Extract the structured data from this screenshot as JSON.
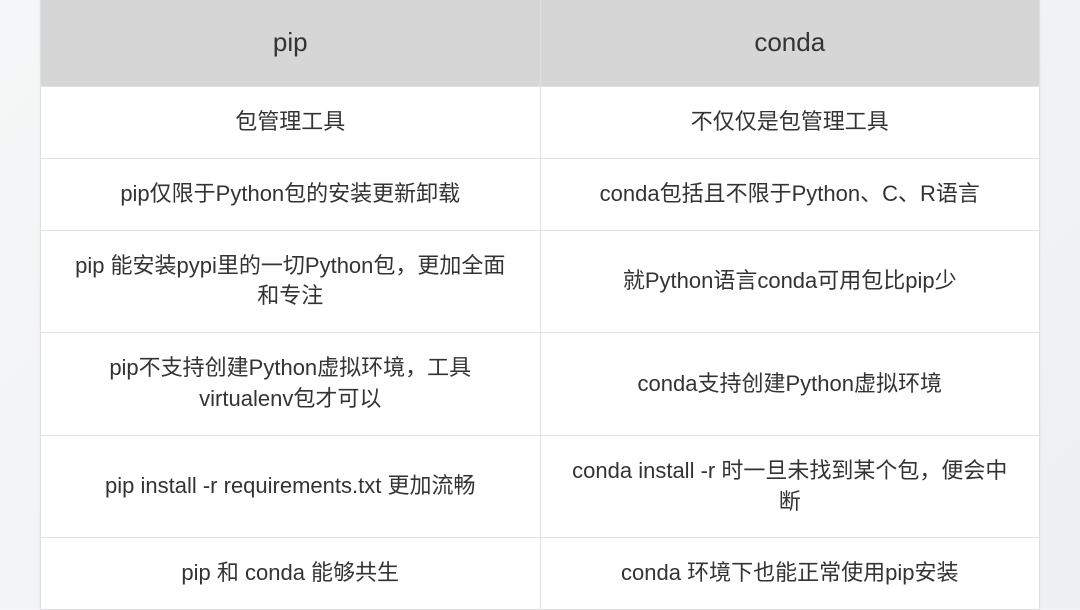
{
  "table": {
    "headers": [
      "pip",
      "conda"
    ],
    "rows": [
      {
        "pip": "包管理工具",
        "conda": "不仅仅是包管理工具"
      },
      {
        "pip": "pip仅限于Python包的安装更新卸载",
        "conda": "conda包括且不限于Python、C、R语言"
      },
      {
        "pip": "pip 能安装pypi里的一切Python包，更加全面和专注",
        "conda": "就Python语言conda可用包比pip少"
      },
      {
        "pip": "pip不支持创建Python虚拟环境，工具virtualenv包才可以",
        "conda": "conda支持创建Python虚拟环境"
      },
      {
        "pip": "pip install -r requirements.txt 更加流畅",
        "conda": "conda install -r 时一旦未找到某个包，便会中断"
      },
      {
        "pip": "pip 和 conda 能够共生",
        "conda": "conda 环境下也能正常使用pip安装"
      }
    ]
  }
}
